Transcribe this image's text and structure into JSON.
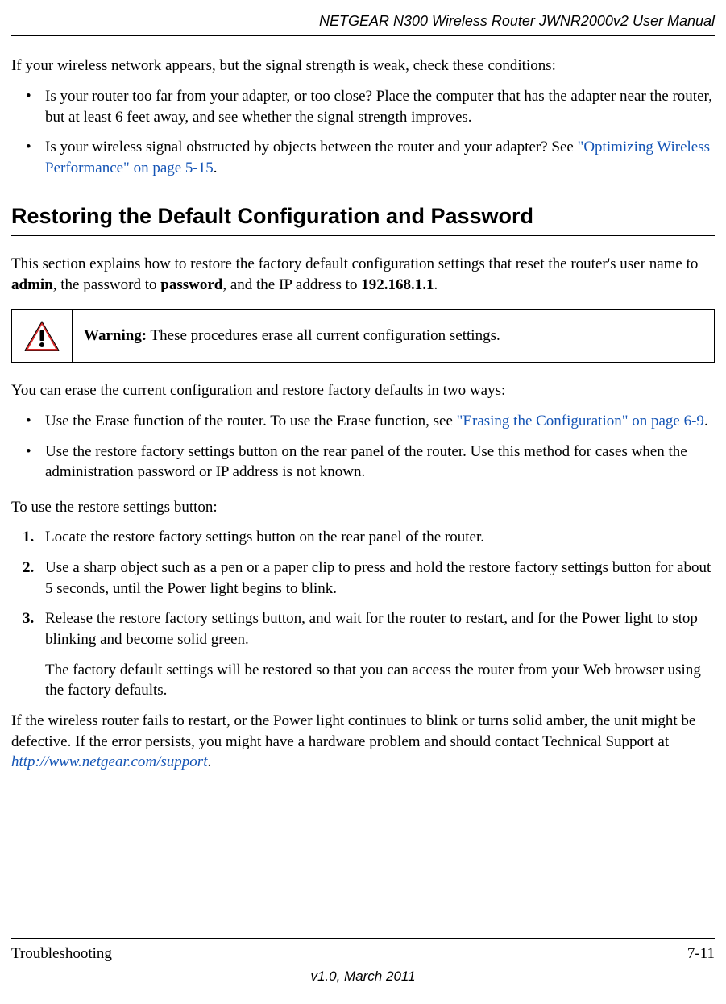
{
  "header": {
    "title": "NETGEAR N300 Wireless Router JWNR2000v2 User Manual"
  },
  "intro": {
    "p1": "If your wireless network appears, but the signal strength is weak, check these conditions:",
    "b1": "Is your router too far from your adapter, or too close? Place the computer that has the adapter near the router, but at least 6 feet away, and see whether the signal strength improves.",
    "b2a": "Is your wireless signal obstructed by objects between the router and your adapter? See ",
    "b2link": "\"Optimizing Wireless Performance\" on page 5-15",
    "b2b": "."
  },
  "section": {
    "heading": "Restoring the Default Configuration and Password",
    "p1a": "This section explains how to restore the factory default configuration settings that reset the router's user name to ",
    "p1b": "admin",
    "p1c": ", the password to ",
    "p1d": "password",
    "p1e": ", and the IP address to ",
    "p1f": "192.168.1.1",
    "p1g": "."
  },
  "warning": {
    "label": "Warning:",
    "text": " These procedures erase all current configuration settings."
  },
  "erase": {
    "p1": "You can erase the current configuration and restore factory defaults in two ways:",
    "b1a": "Use the Erase function of the router. To use the Erase function, see ",
    "b1link": "\"Erasing the Configuration\" on page 6-9",
    "b1b": ".",
    "b2": "Use the restore factory settings button on the rear panel of the router. Use this method for cases when the administration password or IP address is not known.",
    "p2": "To use the restore settings button:"
  },
  "steps": {
    "s1": "Locate the restore factory settings button on the rear panel of the router.",
    "s2": "Use a sharp object such as a pen or a paper clip to press and hold the restore factory settings button for about 5 seconds, until the Power light begins to blink.",
    "s3": "Release the restore factory settings button, and wait for the router to restart, and for the Power light to stop blinking and become solid green.",
    "s3follow": "The factory default settings will be restored so that you can access the router from your Web browser using the factory defaults."
  },
  "closing": {
    "p1a": "If the wireless router fails to restart, or the Power light continues to blink or turns solid amber, the unit might be defective. If the error persists, you might have a hardware problem and should contact Technical Support at ",
    "p1link": "http://www.netgear.com/support",
    "p1b": "."
  },
  "footer": {
    "left": "Troubleshooting",
    "right": "7-11",
    "version": "v1.0, March 2011"
  }
}
